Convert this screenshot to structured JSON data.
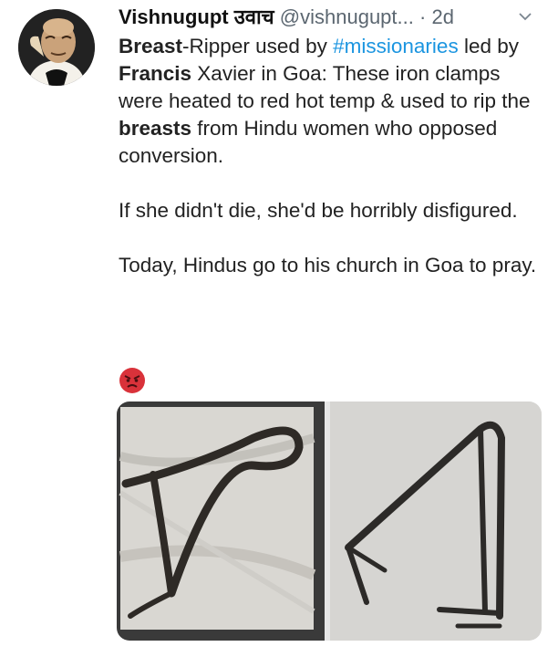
{
  "tweet": {
    "author_name": "Vishnugupt उवाच",
    "handle": "@vishnugupt...",
    "dot": "·",
    "time": "2d",
    "p1": {
      "s1": "Breast",
      "s2": "-Ripper used by ",
      "s3": "#missionaries",
      "s4": " led by ",
      "s5": "Francis",
      "s6": " Xavier in Goa: These iron clamps were heated to red hot temp & used to rip the ",
      "s7": "breasts",
      "s8": " from Hindu women who opposed conversion."
    },
    "p2": "If she didn't die, she'd be horribly disfigured.",
    "p3": "Today, Hindus go to his church in Goa to pray.",
    "emoji_icon": "angry-face-icon",
    "media_icons": [
      "iron-clamp-photo-1",
      "iron-clamp-photo-2"
    ]
  },
  "colors": {
    "link": "#1b95e0",
    "muted": "#5b6670",
    "emoji": "#d9323a"
  }
}
